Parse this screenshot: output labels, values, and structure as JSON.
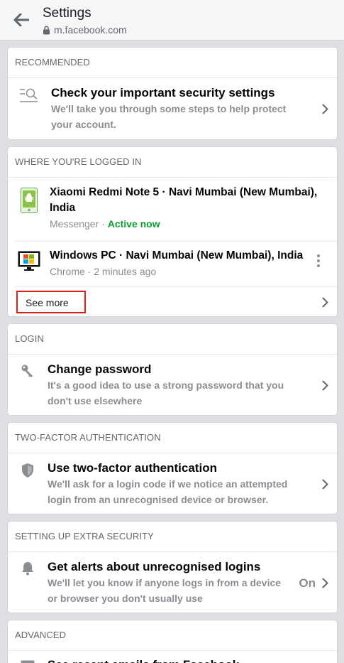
{
  "header": {
    "title": "Settings",
    "url": "m.facebook.com",
    "back_icon": "back-arrow-icon"
  },
  "recommended": {
    "heading": "RECOMMENDED",
    "title": "Check your important security settings",
    "desc_line1": "We'll take you through some steps to help protect",
    "desc_line2": "your account."
  },
  "logged_in": {
    "heading": "WHERE YOU'RE LOGGED IN",
    "sessions": [
      {
        "device_line1": "Xiaomi Redmi Note 5 · Navi Mumbai (New Mumbai),",
        "device_line2": "India",
        "app": "Messenger",
        "separator": " · ",
        "status": "Active now"
      },
      {
        "device_line1": "Windows PC · Navi Mumbai (New Mumbai), India",
        "app": "Chrome",
        "separator": " · ",
        "time": "2 minutes ago"
      }
    ],
    "see_more": "See more"
  },
  "login": {
    "heading": "LOGIN",
    "title": "Change password",
    "desc_line1": "It's a good idea to use a strong password that you",
    "desc_line2": "don't use elsewhere"
  },
  "two_factor": {
    "heading": "TWO-FACTOR AUTHENTICATION",
    "title": "Use two-factor authentication",
    "desc_line1": "We'll ask for a login code if we notice an attempted",
    "desc_line2": "login from an unrecognised device or browser."
  },
  "extra_security": {
    "heading": "SETTING UP EXTRA SECURITY",
    "title": "Get alerts about unrecognised logins",
    "desc_line1": "We'll let you know if anyone logs in from a device",
    "desc_line2": "or browser you don't usually use",
    "state": "On"
  },
  "advanced": {
    "heading": "ADVANCED",
    "title_partial": "See recent emails from Facebook"
  },
  "colors": {
    "active_green": "#0b9f2c",
    "highlight_red": "#e02020",
    "background": "#dddfe2"
  }
}
